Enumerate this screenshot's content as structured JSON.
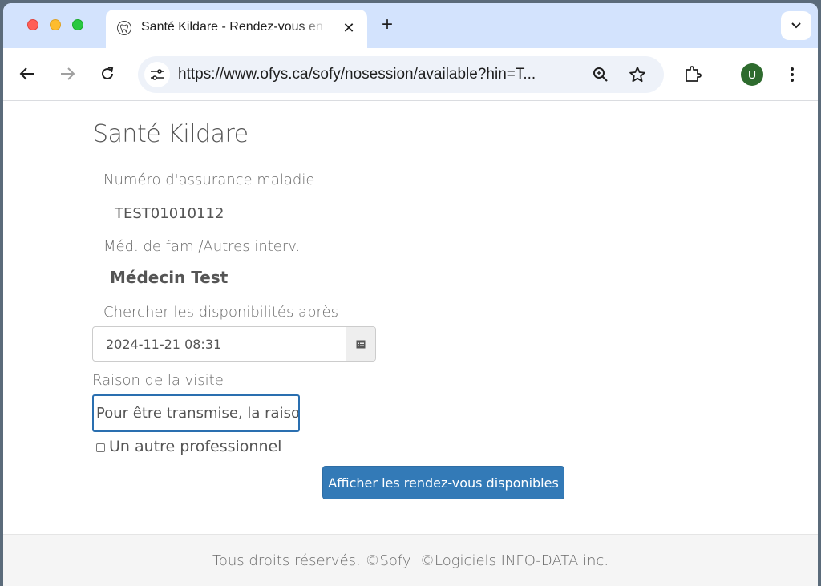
{
  "browser": {
    "tab_title": "Santé Kildare - Rendez-vous en ligne",
    "tab_favicon": "tooth-icon",
    "url": "https://www.ofys.ca/sofy/nosession/available?hin=T...",
    "avatar_initial": "U"
  },
  "page": {
    "clinic_name": "Santé Kildare",
    "health_insurance_label": "Numéro d'assurance maladie",
    "health_insurance_value": "TEST01010112",
    "practitioner_label": "Méd. de fam./Autres interv.",
    "practitioner_value": "Médecin Test",
    "search_after_label": "Chercher les disponibilités après",
    "search_after_value": "2024-11-21 08:31",
    "reason_label": "Raison de la visite",
    "reason_value": "Pour être transmise, la raison",
    "other_professional_label": "Un autre professionnel",
    "other_professional_checked": false,
    "submit_label": "Afficher les rendez-vous disponibles"
  },
  "footer": {
    "text": "Tous droits réservés. ©Sofy  ©Logiciels INFO-DATA inc."
  },
  "colors": {
    "primary_button": "#337ab7",
    "focus_border": "#2a6fb0",
    "tabstrip": "#d3e3fd",
    "avatar": "#2e6b2e"
  }
}
